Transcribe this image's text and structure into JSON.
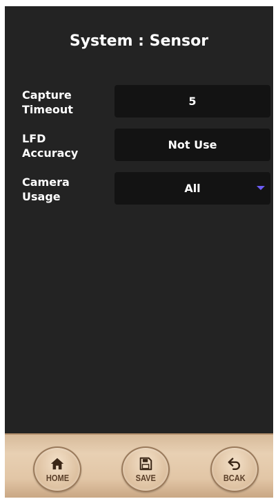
{
  "screen": {
    "title": "System : Sensor"
  },
  "settings": [
    {
      "label_line1": "Capture",
      "label_line2": "Timeout",
      "value": "5"
    },
    {
      "label_line1": "LFD",
      "label_line2": "Accuracy",
      "value": "Not Use"
    },
    {
      "label_line1": "Camera",
      "label_line2": "Usage",
      "value": "All",
      "type": "dropdown"
    }
  ],
  "nav": {
    "home": {
      "label": "HOME",
      "icon": "home-icon"
    },
    "save": {
      "label": "SAVE",
      "icon": "save-icon"
    },
    "back": {
      "label": "BCAK",
      "icon": "back-arrow-icon"
    }
  },
  "colors": {
    "background": "#232323",
    "field_background": "#131313",
    "dropdown_arrow": "#6b5cf5",
    "bar": "#e2c6a6",
    "button_text": "#5a3f29"
  }
}
